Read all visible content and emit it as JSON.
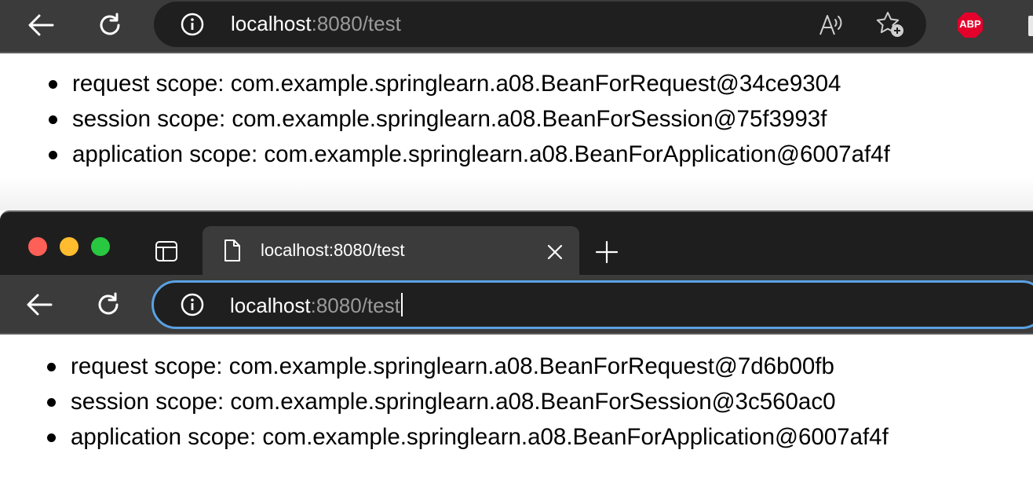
{
  "colors": {
    "toolbar": "#3b3b3b",
    "address_bar": "#1f1f1f",
    "focus_ring": "#5aa1e3",
    "close_dot": "#fe5f57",
    "minimize_dot": "#febc2e",
    "zoom_dot": "#28c840",
    "abp_red": "#e4002b"
  },
  "top_browser": {
    "address": {
      "host": "localhost",
      "rest": ":8080/test"
    },
    "icons": [
      "back-arrow-icon",
      "reload-icon",
      "info-icon",
      "read-aloud-icon",
      "add-favorite-icon",
      "adblock-plus-icon"
    ],
    "abp_label": "ABP",
    "items": [
      "request scope: com.example.springlearn.a08.BeanForRequest@34ce9304",
      "session scope: com.example.springlearn.a08.BeanForSession@75f3993f",
      "application scope: com.example.springlearn.a08.BeanForApplication@6007af4f"
    ]
  },
  "bottom_browser": {
    "tab": {
      "title": "localhost:8080/test"
    },
    "address": {
      "host": "localhost",
      "rest": ":8080/test"
    },
    "icons": [
      "sidebar-icon",
      "page-icon",
      "close-icon",
      "new-tab-icon",
      "back-arrow-icon",
      "reload-icon",
      "info-icon"
    ],
    "items": [
      "request scope: com.example.springlearn.a08.BeanForRequest@7d6b00fb",
      "session scope: com.example.springlearn.a08.BeanForSession@3c560ac0",
      "application scope: com.example.springlearn.a08.BeanForApplication@6007af4f"
    ]
  }
}
